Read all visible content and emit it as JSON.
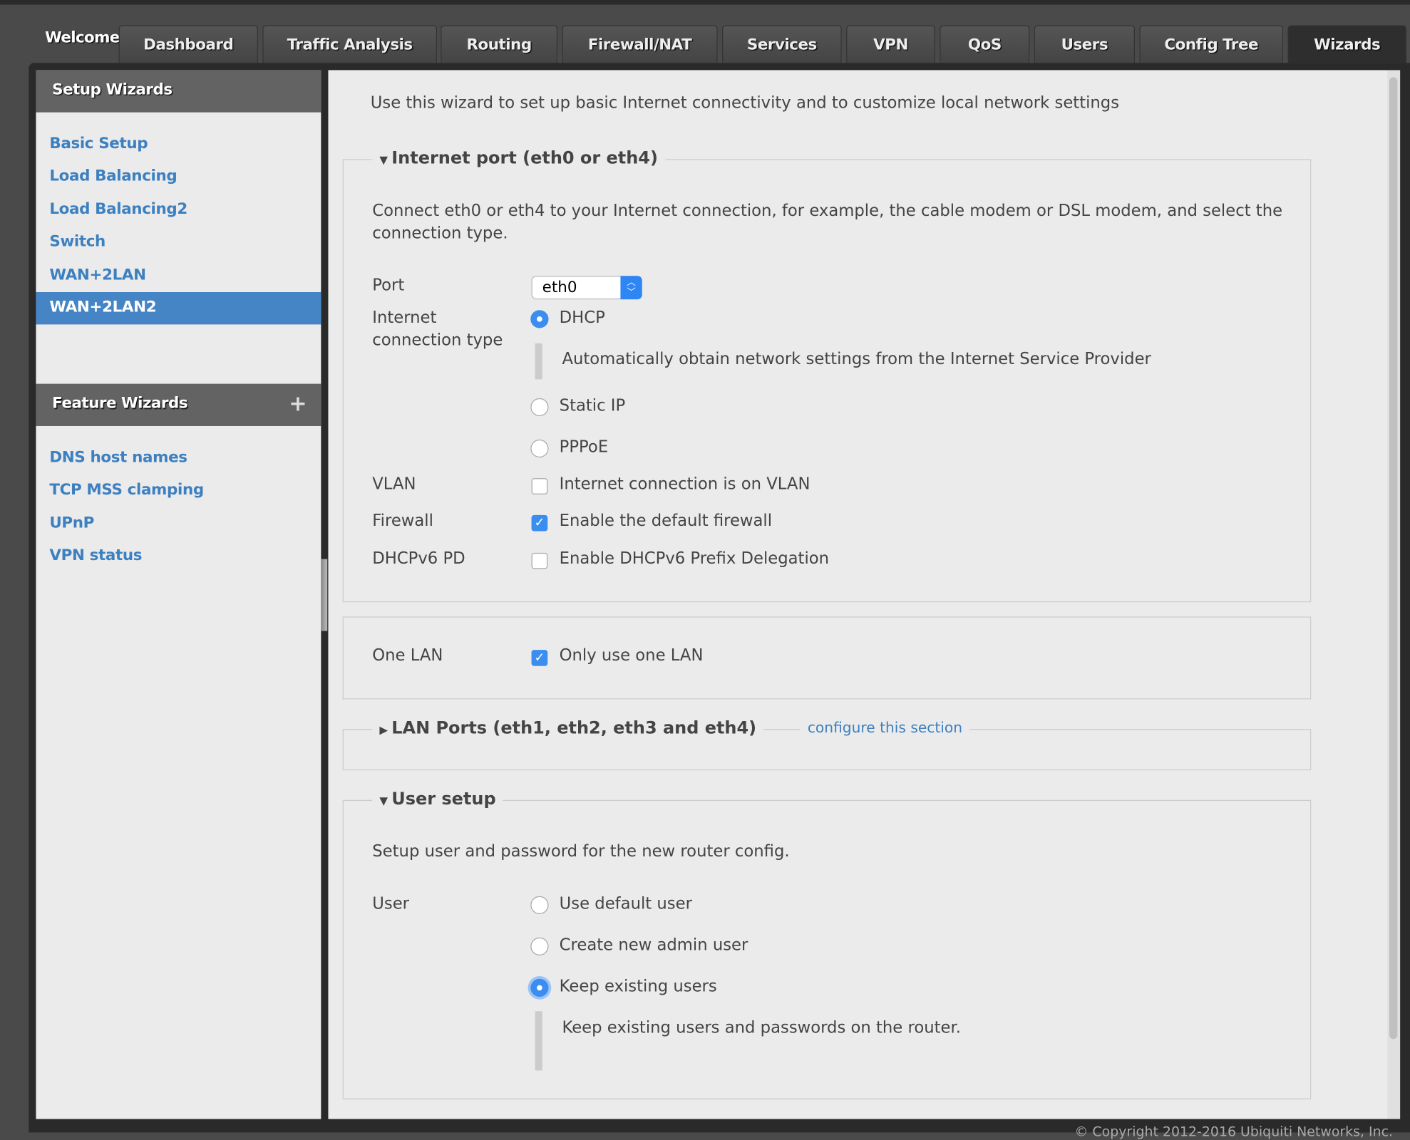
{
  "nav": {
    "welcome": "Welcome",
    "tabs": [
      "Dashboard",
      "Traffic Analysis",
      "Routing",
      "Firewall/NAT",
      "Services",
      "VPN",
      "QoS",
      "Users",
      "Config Tree",
      "Wizards"
    ],
    "active_tab": "Wizards"
  },
  "sidebar": {
    "setup_title": "Setup Wizards",
    "setup_items": [
      "Basic Setup",
      "Load Balancing",
      "Load Balancing2",
      "Switch",
      "WAN+2LAN",
      "WAN+2LAN2"
    ],
    "active_item": "WAN+2LAN2",
    "feature_title": "Feature Wizards",
    "feature_items": [
      "DNS host names",
      "TCP MSS clamping",
      "UPnP",
      "VPN status"
    ],
    "plus_icon": "plus-icon"
  },
  "main": {
    "intro": "Use this wizard to set up basic Internet connectivity and to customize local network settings",
    "internet": {
      "legend": "Internet port (eth0 or eth4)",
      "desc1": "Connect eth0 or eth4 to your Internet connection, for example, the cable modem or DSL modem, and select the",
      "desc2": "connection type.",
      "port_label": "Port",
      "port_value": "eth0",
      "conn_label1": "Internet",
      "conn_label2": "connection type",
      "dhcp": "DHCP",
      "dhcp_help": "Automatically obtain network settings from the Internet Service Provider",
      "static": "Static IP",
      "pppoe": "PPPoE",
      "selected": "DHCP",
      "vlan_label": "VLAN",
      "vlan_text": "Internet connection is on VLAN",
      "vlan_checked": false,
      "fw_label": "Firewall",
      "fw_text": "Enable the default firewall",
      "fw_checked": true,
      "pd_label": "DHCPv6 PD",
      "pd_text": "Enable DHCPv6 Prefix Delegation",
      "pd_checked": false
    },
    "onelan": {
      "label": "One LAN",
      "text": "Only use one LAN",
      "checked": true
    },
    "lan": {
      "legend": "LAN Ports (eth1, eth2, eth3 and eth4)",
      "link": "configure this section"
    },
    "user": {
      "legend": "User setup",
      "desc": "Setup user and password for the new router config.",
      "label": "User",
      "opt1": "Use default user",
      "opt2": "Create new admin user",
      "opt3": "Keep existing users",
      "selected": "Keep existing users",
      "help": "Keep existing users and passwords on the router."
    }
  },
  "footer": {
    "copyright": "© Copyright 2012-2016 Ubiquiti Networks, Inc."
  },
  "colors": {
    "accent": "#3b8ef0",
    "link": "#3d80c0",
    "active_item": "#4585c5"
  }
}
